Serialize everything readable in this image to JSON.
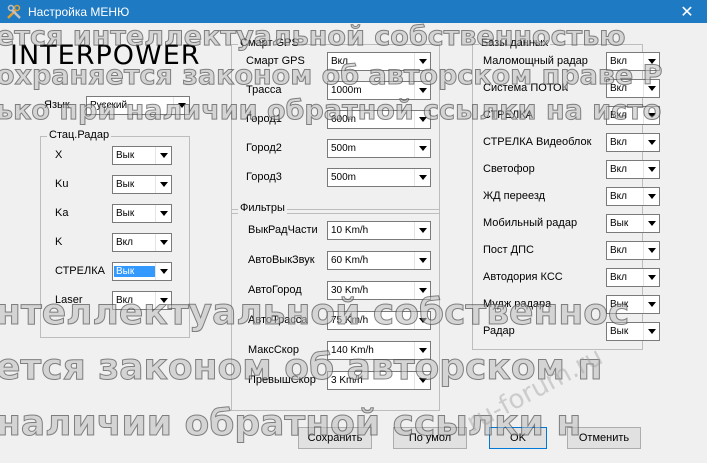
{
  "window": {
    "title": "Настройка МЕНЮ",
    "close_glyph": "✕"
  },
  "logo": {
    "text": "INTERPOWER"
  },
  "language": {
    "label": "Язык",
    "value": "Русский"
  },
  "radar_group": {
    "title": "Стац.Радар",
    "rows": [
      {
        "label": "X",
        "value": "Вык",
        "selected": false
      },
      {
        "label": "Ku",
        "value": "Вык",
        "selected": false
      },
      {
        "label": "Ka",
        "value": "Вык",
        "selected": false
      },
      {
        "label": "K",
        "value": "Вкл",
        "selected": false
      },
      {
        "label": "СТРЕЛКА",
        "value": "Вык",
        "selected": true
      },
      {
        "label": "Laser",
        "value": "Вкл",
        "selected": false
      }
    ]
  },
  "gps_group": {
    "title": "Смарт GPS",
    "rows": [
      {
        "label": "Смарт GPS",
        "value": "Вкл"
      },
      {
        "label": "Трасса",
        "value": "1000m"
      },
      {
        "label": "Город1",
        "value": "600m"
      },
      {
        "label": "Город2",
        "value": "500m"
      },
      {
        "label": "Город3",
        "value": "500m"
      }
    ]
  },
  "filters_group": {
    "title": "Фильтры",
    "rows": [
      {
        "label": "ВыкРадЧасти",
        "value": "10 Km/h"
      },
      {
        "label": "АвтоВыкЗвук",
        "value": "60 Km/h"
      },
      {
        "label": "АвтоГород",
        "value": "30 Km/h"
      },
      {
        "label": "АвтоТрасса",
        "value": "75 Km/h"
      },
      {
        "label": "МаксСкор",
        "value": "140 Km/h"
      },
      {
        "label": "ПревышСкор",
        "value": "3 Km/h"
      }
    ]
  },
  "db_group": {
    "title": "Базы данных",
    "rows": [
      {
        "label": "Маломощный радар",
        "value": "Вкл"
      },
      {
        "label": "Система ПОТОК",
        "value": "Вкл"
      },
      {
        "label": "СТРЕЛКА",
        "value": "Вкл"
      },
      {
        "label": "СТРЕЛКА Видеоблок",
        "value": "Вкл"
      },
      {
        "label": "Светофор",
        "value": "Вкл"
      },
      {
        "label": "ЖД переезд",
        "value": "Вкл"
      },
      {
        "label": "Мобильный радар",
        "value": "Вык"
      },
      {
        "label": "Пост ДПС",
        "value": "Вкл"
      },
      {
        "label": "Автодория КСС",
        "value": "Вкл"
      },
      {
        "label": "Мудж радара",
        "value": "Вык"
      },
      {
        "label": "Радар",
        "value": "Вык"
      }
    ]
  },
  "buttons": {
    "save": "Сохранить",
    "default": "По умол",
    "ok": "OK",
    "cancel": "Отменить"
  },
  "watermark": {
    "line1": "ется интеллектуальной собственностью",
    "line2": "охраняется законом об авторском праве Р",
    "line3": "ько при наличии обратной ссылки на исто",
    "line4": "нтеллектуальной собственнос",
    "line5": "ется законом об авторском п",
    "line6": "наличии обратной ссылки н",
    "site": "ru-forum.ru"
  },
  "colors": {
    "titlebar": "#1f7ac4",
    "selection": "#3399ff",
    "background": "#f0f0f0"
  }
}
